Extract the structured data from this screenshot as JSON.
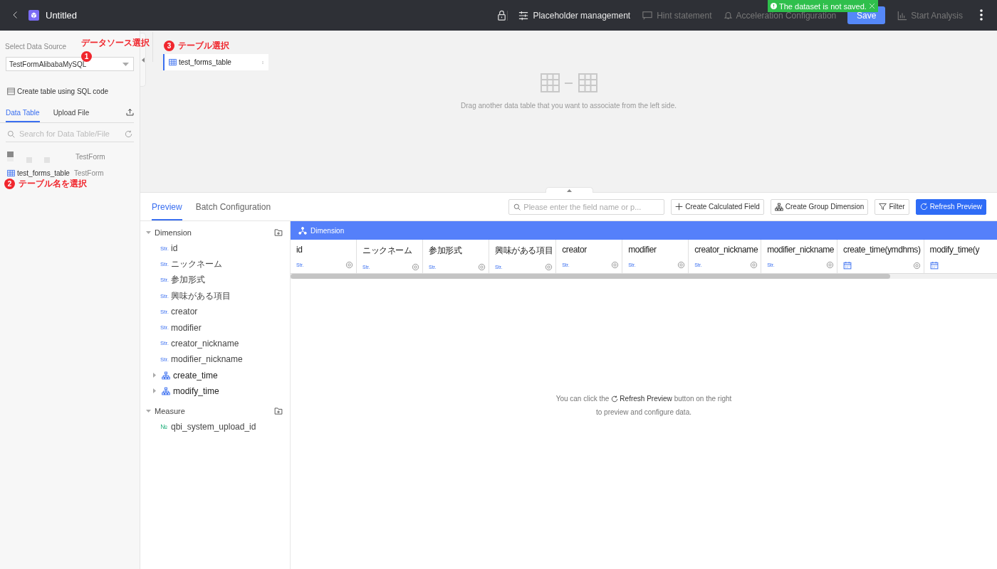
{
  "topbar": {
    "title": "Untitled",
    "actions": [
      {
        "kind": "lock"
      },
      {
        "kind": "placeholder",
        "label": "Placeholder management",
        "disabled": false
      },
      {
        "kind": "hint",
        "label": "Hint statement",
        "disabled": true
      },
      {
        "kind": "accel",
        "label": "Acceleration Configuration",
        "disabled": true
      },
      {
        "kind": "save",
        "label": "Save"
      },
      {
        "kind": "analysis",
        "label": "Start Analysis",
        "disabled": true
      }
    ]
  },
  "toast": {
    "message": "The dataset is not saved."
  },
  "sidebar": {
    "source_label": "Select Data Source",
    "source_value": "TestFormAlibabaMySQL",
    "sql_link": "Create table using SQL code",
    "tabs": [
      {
        "label": "Data Table",
        "selected": true
      },
      {
        "label": "Upload File",
        "selected": false
      }
    ],
    "search_placeholder": "Search for Data Table/File",
    "tables": [
      {
        "kind": "redacted",
        "source": "TestForm"
      },
      {
        "kind": "table",
        "name": "test_forms_table",
        "source": "TestForm"
      }
    ]
  },
  "annotations": [
    {
      "number": "1",
      "label": "データソース選択"
    },
    {
      "number": "2",
      "label": "テーブル名を選択"
    },
    {
      "number": "3",
      "label": "テーブル選択"
    }
  ],
  "canvas": {
    "tables": [
      {
        "name": "test_forms_table"
      }
    ],
    "hint": "Drag another data table that you want to associate from the left side."
  },
  "preview": {
    "tabs": [
      {
        "label": "Preview",
        "selected": true
      },
      {
        "label": "Batch Configuration",
        "selected": false
      }
    ],
    "search_placeholder": "Please enter the field name or p...",
    "buttons": [
      {
        "kind": "add",
        "label": "Create Calculated Field"
      },
      {
        "kind": "group",
        "label": "Create Group Dimension"
      },
      {
        "kind": "filter",
        "label": "Filter"
      },
      {
        "kind": "refresh",
        "label": "Refresh Preview"
      }
    ],
    "fields": [
      {
        "label": "Dimension",
        "expanded": true,
        "children": [
          {
            "kind": "str",
            "type": "Str.",
            "name": "id"
          },
          {
            "kind": "str",
            "type": "Str.",
            "name": "ニックネーム"
          },
          {
            "kind": "str",
            "type": "Str.",
            "name": "参加形式"
          },
          {
            "kind": "str",
            "type": "Str.",
            "name": "興味がある項目"
          },
          {
            "kind": "str",
            "type": "Str.",
            "name": "creator"
          },
          {
            "kind": "str",
            "type": "Str.",
            "name": "modifier"
          },
          {
            "kind": "str",
            "type": "Str.",
            "name": "creator_nickname"
          },
          {
            "kind": "str",
            "type": "Str.",
            "name": "modifier_nickname"
          },
          {
            "kind": "group",
            "name": "create_time",
            "expanded": false
          },
          {
            "kind": "group",
            "name": "modify_time",
            "expanded": false
          }
        ]
      },
      {
        "label": "Measure",
        "expanded": true,
        "children": [
          {
            "kind": "num",
            "type": "№",
            "name": "qbi_system_upload_id"
          }
        ]
      }
    ],
    "table": {
      "group": "Dimension",
      "columns": [
        {
          "name": "id",
          "kind": "str",
          "type": "Str."
        },
        {
          "name": "ニックネーム",
          "kind": "str",
          "type": "Str."
        },
        {
          "name": "参加形式",
          "kind": "str",
          "type": "Str."
        },
        {
          "name": "興味がある項目",
          "kind": "str",
          "type": "Str."
        },
        {
          "name": "creator",
          "kind": "str",
          "type": "Str."
        },
        {
          "name": "modifier",
          "kind": "str",
          "type": "Str."
        },
        {
          "name": "creator_nickname",
          "kind": "str",
          "type": "Str."
        },
        {
          "name": "modifier_nickname",
          "kind": "str",
          "type": "Str."
        },
        {
          "name": "create_time(ymdhms)",
          "kind": "date"
        },
        {
          "name": "modify_time(y",
          "kind": "date"
        }
      ]
    }
  },
  "empty": {
    "before": "You can click the",
    "link": "Refresh Preview",
    "after": "button on the right",
    "line2": "to preview and configure data."
  }
}
